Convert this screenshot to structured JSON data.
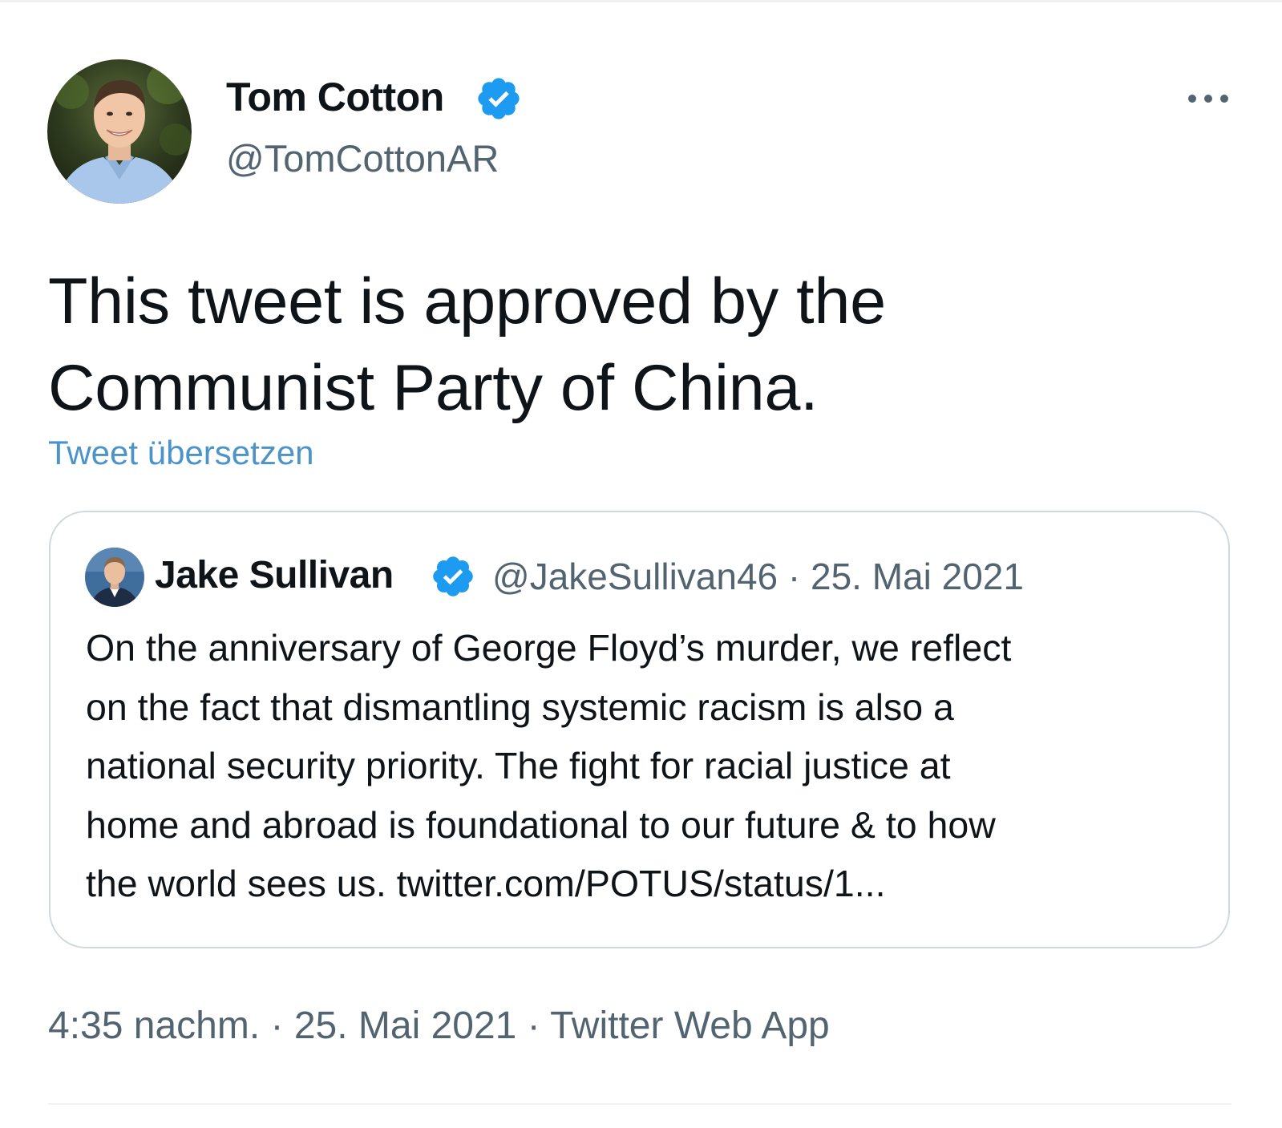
{
  "tweet": {
    "author_name": "Tom Cotton",
    "author_handle": "@TomCottonAR",
    "verified": true,
    "text_lines": [
      "This tweet is approved by the",
      "Communist Party of China."
    ],
    "translate_label": "Tweet übersetzen",
    "timestamp": "4:35 nachm. · 25. Mai 2021 · Twitter Web App"
  },
  "quoted_tweet": {
    "author_name": "Jake Sullivan",
    "verified": true,
    "meta": "@JakeSullivan46 · 25. Mai 2021",
    "text_lines": [
      "On the anniversary of George Floyd’s murder, we reflect",
      "on the fact that dismantling systemic racism is also a",
      "national security priority. The fight for racial justice at",
      "home and abroad is foundational to our future & to how",
      "the world sees us. twitter.com/POTUS/status/1..."
    ]
  },
  "icons": {
    "more": "more-horizontal-icon",
    "verified": "verified-badge-icon"
  },
  "colors": {
    "verified_blue": "#1d9bf0",
    "link_blue": "#4b93c8",
    "secondary_text": "#536471",
    "primary_text": "#0f1419",
    "border": "#cfd9de"
  }
}
